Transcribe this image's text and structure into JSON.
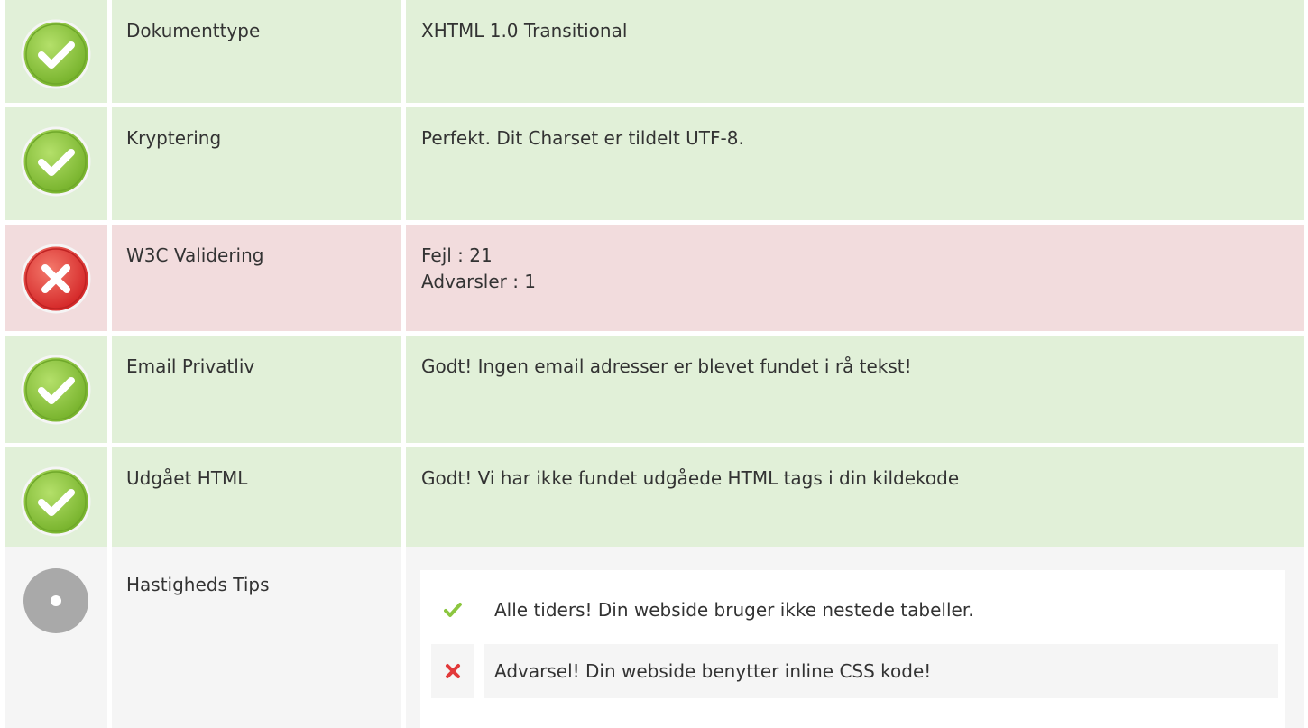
{
  "rows": [
    {
      "label": "Dokumenttype",
      "value_lines": [
        "XHTML 1.0 Transitional"
      ],
      "status": "ok",
      "icon": "check-circle-icon"
    },
    {
      "label": "Kryptering",
      "value_lines": [
        "Perfekt. Dit Charset er tildelt UTF-8."
      ],
      "status": "ok",
      "icon": "check-circle-icon"
    },
    {
      "label": "W3C Validering",
      "value_lines": [
        "Fejl : 21",
        "Advarsler : 1"
      ],
      "status": "error",
      "icon": "x-circle-icon"
    },
    {
      "label": "Email Privatliv",
      "value_lines": [
        "Godt! Ingen email adresser er blevet fundet i rå tekst!"
      ],
      "status": "ok",
      "icon": "check-circle-icon"
    },
    {
      "label": "Udgået HTML",
      "value_lines": [
        "Godt! Vi har ikke fundet udgåede HTML tags i din kildekode"
      ],
      "status": "ok",
      "icon": "check-circle-icon"
    },
    {
      "label": "Hastigheds Tips",
      "status": "neutral",
      "icon": "neutral-circle-icon",
      "tips": [
        {
          "text": "Alle tiders! Din webside bruger ikke nestede tabeller.",
          "status": "ok",
          "icon": "checkmark-icon"
        },
        {
          "text": "Advarsel! Din webside benytter inline CSS kode!",
          "status": "warning",
          "icon": "cross-icon"
        }
      ]
    }
  ],
  "colors": {
    "ok_bg": "#e1f0d8",
    "error_bg": "#f2dcdd",
    "neutral_bg": "#f5f5f5",
    "ok_icon": "#8cc63f",
    "error_icon": "#e2393a",
    "neutral_icon": "#aaaaaa"
  }
}
